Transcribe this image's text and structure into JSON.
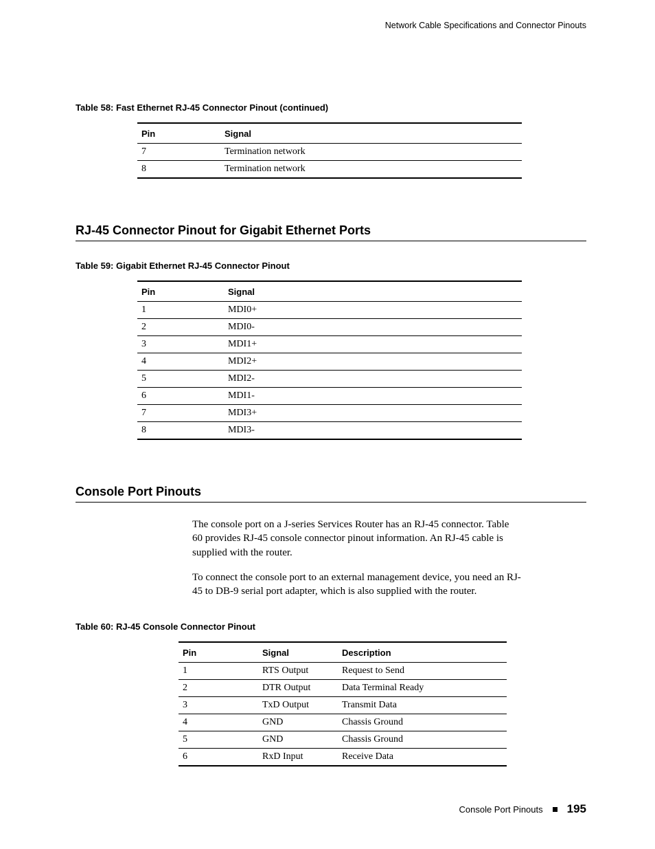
{
  "header": {
    "running_title": "Network Cable Specifications and Connector Pinouts"
  },
  "table58": {
    "caption": "Table 58:  Fast Ethernet RJ-45 Connector Pinout (continued)",
    "headers": {
      "pin": "Pin",
      "signal": "Signal"
    },
    "rows": [
      {
        "pin": "7",
        "signal": "Termination network"
      },
      {
        "pin": "8",
        "signal": "Termination network"
      }
    ]
  },
  "section1": {
    "heading": "RJ-45 Connector Pinout for Gigabit Ethernet Ports"
  },
  "table59": {
    "caption": "Table 59:  Gigabit Ethernet RJ-45 Connector Pinout",
    "headers": {
      "pin": "Pin",
      "signal": "Signal"
    },
    "rows": [
      {
        "pin": "1",
        "signal": "MDI0+"
      },
      {
        "pin": "2",
        "signal": "MDI0-"
      },
      {
        "pin": "3",
        "signal": "MDI1+"
      },
      {
        "pin": "4",
        "signal": "MDI2+"
      },
      {
        "pin": "5",
        "signal": "MDI2-"
      },
      {
        "pin": "6",
        "signal": "MDI1-"
      },
      {
        "pin": "7",
        "signal": "MDI3+"
      },
      {
        "pin": "8",
        "signal": "MDI3-"
      }
    ]
  },
  "section2": {
    "heading": "Console Port Pinouts",
    "para1": "The console port on a J-series Services Router has an RJ-45 connector. Table 60 provides RJ-45 console connector pinout information.  An RJ-45 cable is supplied with the router.",
    "para2": "To connect the console port to an external management device, you need an RJ-45 to DB-9 serial port adapter, which is also supplied with the router."
  },
  "table60": {
    "caption": "Table 60:  RJ-45 Console Connector Pinout",
    "headers": {
      "pin": "Pin",
      "signal": "Signal",
      "description": "Description"
    },
    "rows": [
      {
        "pin": "1",
        "signal": "RTS Output",
        "description": "Request to Send"
      },
      {
        "pin": "2",
        "signal": "DTR Output",
        "description": "Data Terminal Ready"
      },
      {
        "pin": "3",
        "signal": "TxD Output",
        "description": "Transmit Data"
      },
      {
        "pin": "4",
        "signal": "GND",
        "description": "Chassis Ground"
      },
      {
        "pin": "5",
        "signal": "GND",
        "description": "Chassis Ground"
      },
      {
        "pin": "6",
        "signal": "RxD Input",
        "description": "Receive Data"
      }
    ]
  },
  "footer": {
    "section_label": "Console Port Pinouts",
    "page_number": "195"
  }
}
